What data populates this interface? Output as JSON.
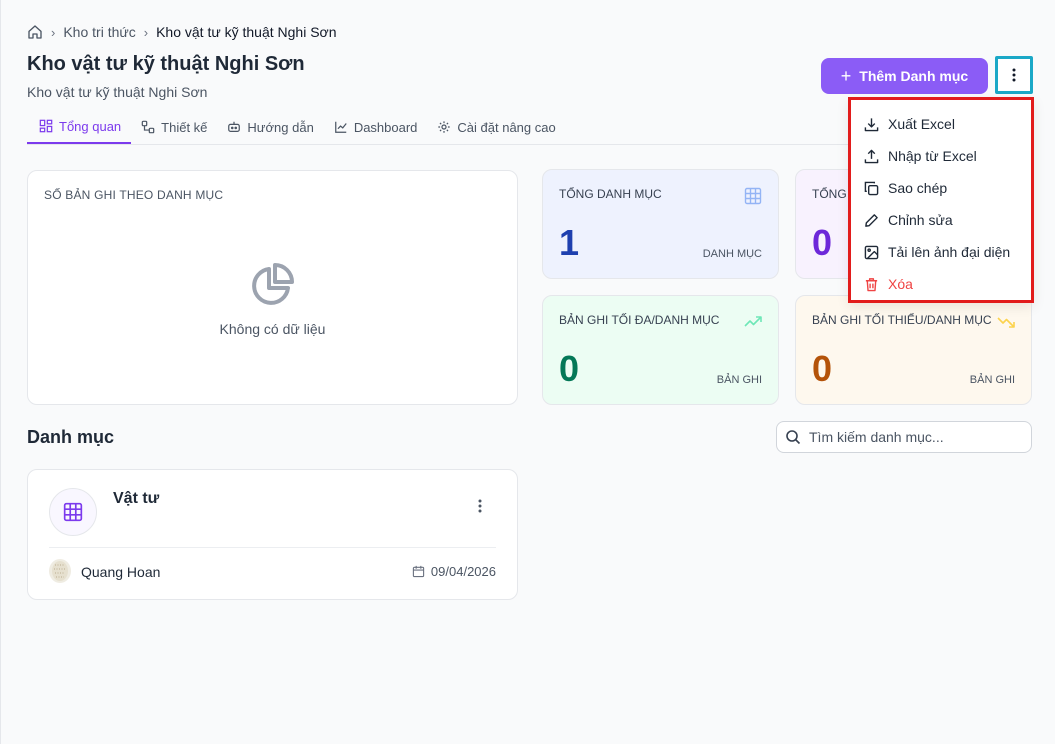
{
  "breadcrumb": {
    "items": [
      "Kho tri thức",
      "Kho vật tư kỹ thuật Nghi Sơn"
    ]
  },
  "header": {
    "title": "Kho vật tư kỹ thuật Nghi Sơn",
    "subtitle": "Kho vật tư kỹ thuật Nghi Sơn",
    "add_label": "Thêm Danh mục"
  },
  "tabs": [
    {
      "label": "Tổng quan",
      "icon": "dashboard-grid-icon",
      "active": true
    },
    {
      "label": "Thiết kế",
      "icon": "design-icon"
    },
    {
      "label": "Hướng dẫn",
      "icon": "robot-icon"
    },
    {
      "label": "Dashboard",
      "icon": "line-chart-icon"
    },
    {
      "label": "Cài đặt nâng cao",
      "icon": "gear-icon"
    }
  ],
  "menu": {
    "items": [
      {
        "label": "Xuất Excel",
        "icon": "download-icon"
      },
      {
        "label": "Nhập từ Excel",
        "icon": "upload-icon"
      },
      {
        "label": "Sao chép",
        "icon": "copy-icon"
      },
      {
        "label": "Chỉnh sửa",
        "icon": "pencil-icon"
      },
      {
        "label": "Tải lên ảnh đại diện",
        "icon": "image-icon"
      },
      {
        "label": "Xóa",
        "icon": "trash-icon",
        "color": "#ef4444"
      }
    ]
  },
  "chart_card": {
    "title": "SỐ BẢN GHI THEO DANH MỤC",
    "empty_text": "Không có dữ liệu"
  },
  "stats": [
    {
      "label": "TỔNG DANH MỤC",
      "value": "1",
      "unit": "DANH MỤC",
      "color": "#1e40af"
    },
    {
      "label": "TỔNG",
      "value": "0",
      "unit": "",
      "color": "#6d28d9"
    },
    {
      "label": "BẢN GHI TỐI ĐA/DANH MỤC",
      "value": "0",
      "unit": "BẢN GHI",
      "color": "#047857"
    },
    {
      "label": "BẢN GHI TỐI THIỂU/DANH MỤC",
      "value": "0",
      "unit": "BẢN GHI",
      "color": "#b45309"
    }
  ],
  "categories": {
    "title": "Danh mục",
    "search_placeholder": "Tìm kiếm danh mục...",
    "items": [
      {
        "name": "Vật tư",
        "owner": "Quang Hoan",
        "date": "09/04/2026"
      }
    ]
  },
  "colors": {
    "accent": "#8b5cf6",
    "highlight_outline": "#1ba8c7",
    "menu_outline": "#e21c1c"
  }
}
